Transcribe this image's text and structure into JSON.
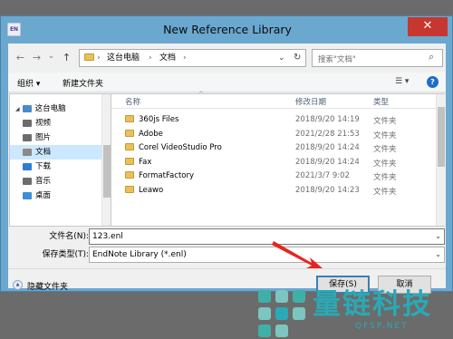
{
  "window": {
    "title": "New Reference Library",
    "app_icon": "EN",
    "close_glyph": "✕"
  },
  "nav": {
    "back_glyph": "←",
    "forward_glyph": "→",
    "recent_glyph": "⌄",
    "up_glyph": "↑",
    "breadcrumb": [
      "这台电脑",
      "文档"
    ],
    "sep_glyph": "›",
    "dropdown_glyph": "⌄",
    "refresh_glyph": "↻",
    "search_placeholder": "搜索\"文档\"",
    "search_glyph": "⌕"
  },
  "toolbar": {
    "organize": "组织 ▾",
    "new_folder": "新建文件夹",
    "view_glyph": "☰ ▾",
    "help_glyph": "?"
  },
  "tree": {
    "items": [
      {
        "label": "这台电脑",
        "icon": "computer-icon",
        "color": "#4a8bc9"
      },
      {
        "label": "视频",
        "icon": "video-folder-icon",
        "color": "#6c6c6c"
      },
      {
        "label": "图片",
        "icon": "pictures-folder-icon",
        "color": "#6c6c6c"
      },
      {
        "label": "文档",
        "icon": "documents-folder-icon",
        "color": "#8a8a8a"
      },
      {
        "label": "下载",
        "icon": "downloads-folder-icon",
        "color": "#2d7dd2"
      },
      {
        "label": "音乐",
        "icon": "music-folder-icon",
        "color": "#6c6c6c"
      },
      {
        "label": "桌面",
        "icon": "desktop-folder-icon",
        "color": "#3c8fd8"
      }
    ],
    "selected_index": 3
  },
  "list": {
    "headers": {
      "name": "名称",
      "date": "修改日期",
      "type": "类型"
    },
    "sort_glyph": "^",
    "rows": [
      {
        "name": "360js Files",
        "date": "2018/9/20 14:19",
        "type": "文件夹"
      },
      {
        "name": "Adobe",
        "date": "2021/2/28 21:53",
        "type": "文件夹"
      },
      {
        "name": "Corel VideoStudio Pro",
        "date": "2018/9/20 14:24",
        "type": "文件夹"
      },
      {
        "name": "Fax",
        "date": "2018/9/20 14:24",
        "type": "文件夹"
      },
      {
        "name": "FormatFactory",
        "date": "2021/3/7 9:02",
        "type": "文件夹"
      },
      {
        "name": "Leawo",
        "date": "2018/9/20 14:23",
        "type": "文件夹"
      }
    ]
  },
  "form": {
    "filename_label": "文件名(N):",
    "filename_value": "123.enl",
    "filetype_label": "保存类型(T):",
    "filetype_value": "EndNote Library (*.enl)",
    "combo_glyph": "⌄"
  },
  "footer": {
    "hide_folders": "隐藏文件夹",
    "hide_glyph": "▲",
    "save": "保存(S)",
    "cancel": "取消"
  },
  "watermark": {
    "text": "量链科技",
    "url": "QFSP.NET"
  },
  "colors": {
    "window_frame": "#6aa8cf",
    "close_button": "#c7372f",
    "selection": "#cce8ff",
    "annotation_arrow": "#e8231f",
    "watermark": "#2aa9b6"
  }
}
